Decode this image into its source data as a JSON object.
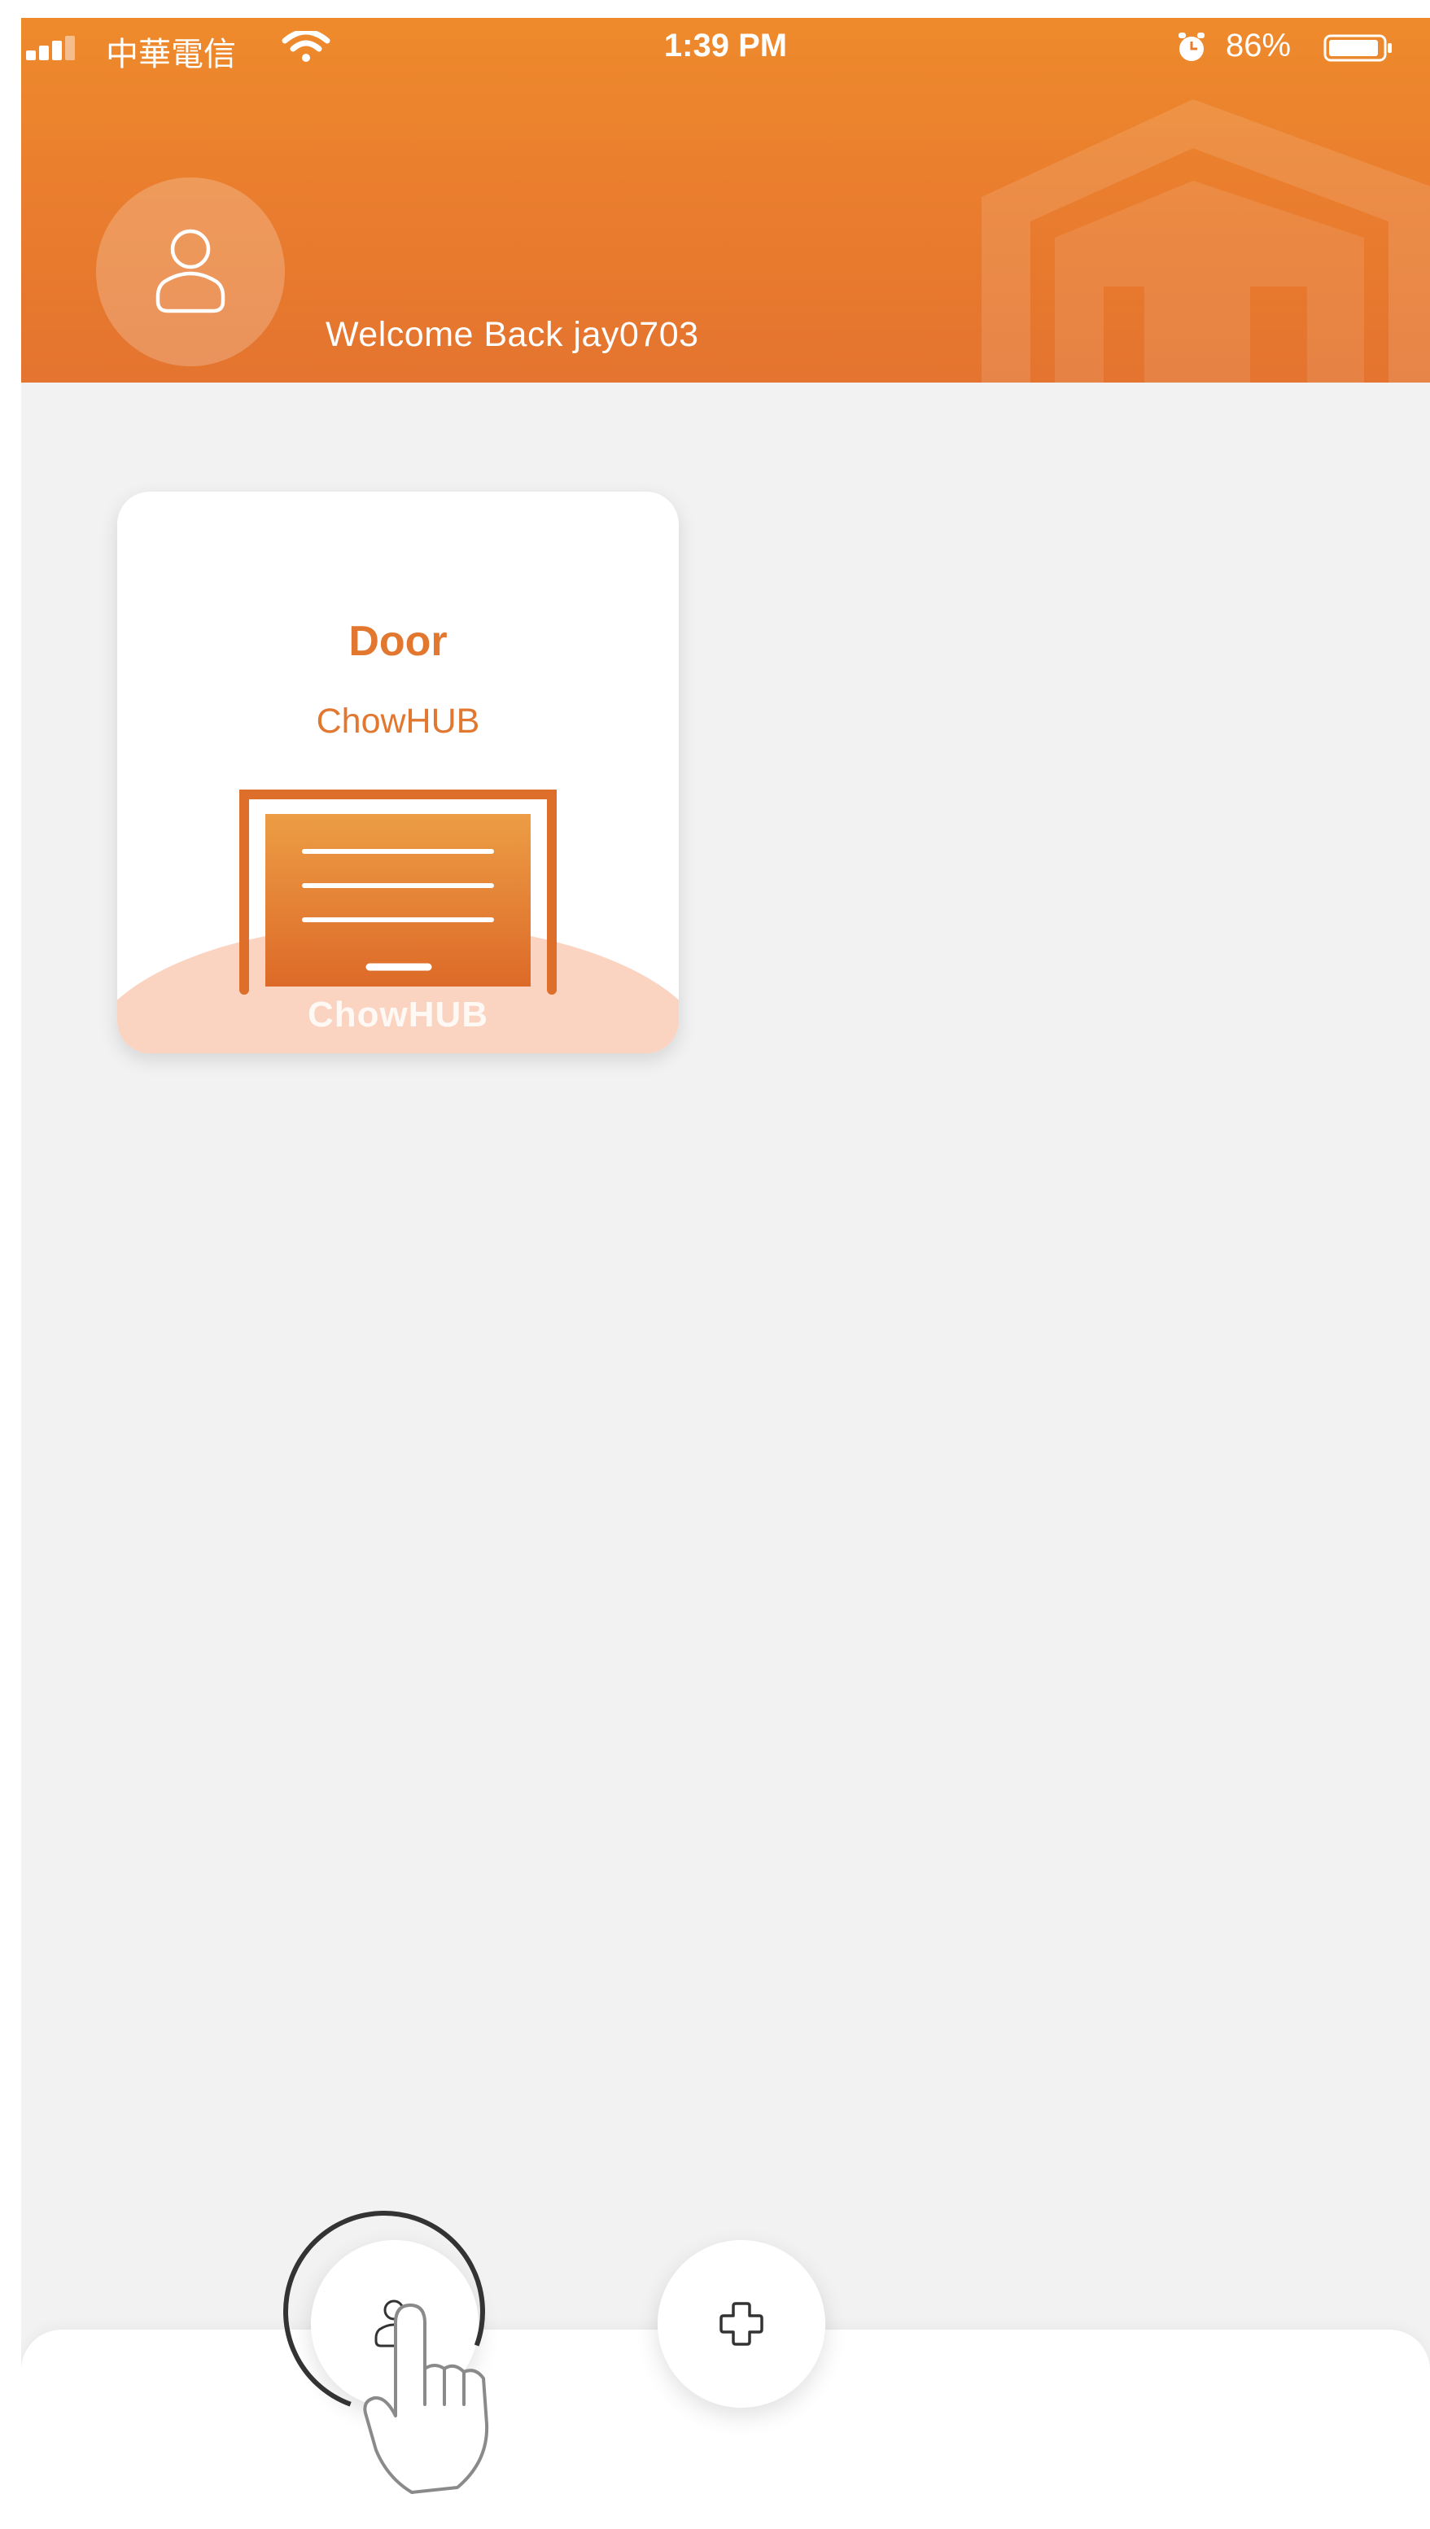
{
  "status_bar": {
    "carrier": "中華電信",
    "time": "1:39 PM",
    "battery": "86%"
  },
  "header": {
    "welcome_prefix": "Welcome Back ",
    "username": "jay0703",
    "accent_color": "#e97c2e"
  },
  "devices": [
    {
      "title": "Door",
      "subtitle": "ChowHUB",
      "footer_label": "ChowHUB",
      "icon": "garage-door-icon"
    }
  ],
  "bottom_bar": {
    "buttons": [
      {
        "icon": "user-icon"
      },
      {
        "icon": "add-icon"
      }
    ]
  },
  "overlay": {
    "icon": "tap-hand-icon"
  }
}
